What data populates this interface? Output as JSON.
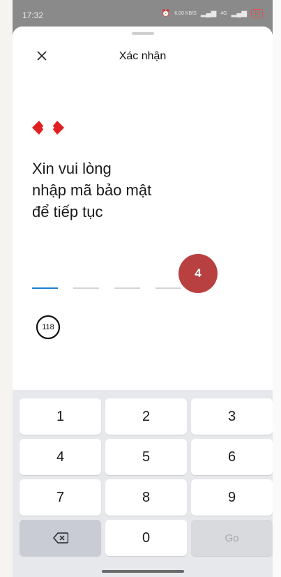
{
  "status_bar": {
    "time": "17:32",
    "net_speed": "6,00 KB/S",
    "network": "4G",
    "battery": "19"
  },
  "sheet": {
    "title": "Xác nhận",
    "prompt_line1": "Xin vui lòng",
    "prompt_line2": "nhập mã bảo mật",
    "prompt_line3": "để tiếp tục"
  },
  "annotation": {
    "step": "4"
  },
  "timer": {
    "seconds": "118"
  },
  "keypad": {
    "k1": "1",
    "k2": "2",
    "k3": "3",
    "k4": "4",
    "k5": "5",
    "k6": "6",
    "k7": "7",
    "k8": "8",
    "k9": "9",
    "k0": "0",
    "go": "Go"
  },
  "colors": {
    "accent": "#1a7fd0",
    "brand_red": "#e02020",
    "badge": "#b94040"
  },
  "icons": [
    "close-icon",
    "bank-logo-icon",
    "timer-ring-icon",
    "backspace-icon",
    "alarm-icon",
    "signal-icon",
    "battery-icon"
  ]
}
